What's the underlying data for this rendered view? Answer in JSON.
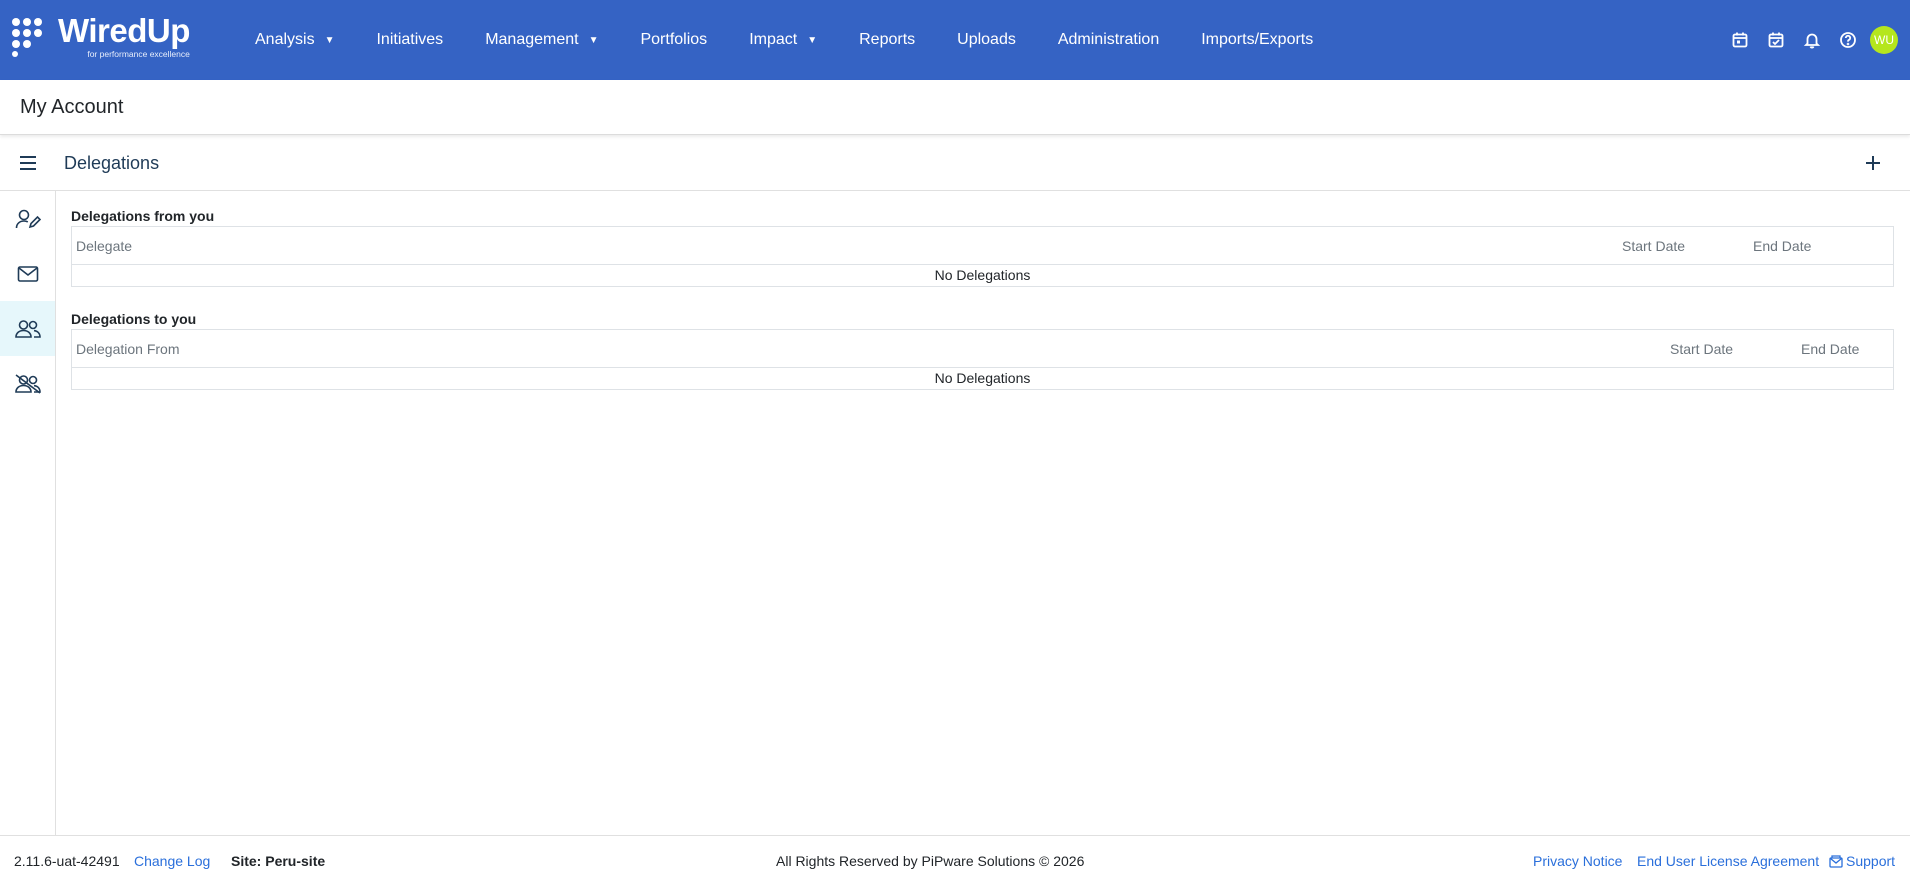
{
  "brand": {
    "name": "WiredUp",
    "tagline": "for performance excellence"
  },
  "nav": {
    "items": [
      {
        "label": "Analysis",
        "has_dropdown": true
      },
      {
        "label": "Initiatives",
        "has_dropdown": false
      },
      {
        "label": "Management",
        "has_dropdown": true
      },
      {
        "label": "Portfolios",
        "has_dropdown": false
      },
      {
        "label": "Impact",
        "has_dropdown": true
      },
      {
        "label": "Reports",
        "has_dropdown": false
      },
      {
        "label": "Uploads",
        "has_dropdown": false
      },
      {
        "label": "Administration",
        "has_dropdown": false
      },
      {
        "label": "Imports/Exports",
        "has_dropdown": false
      }
    ],
    "icons": [
      "calendar-icon",
      "calendar-check-icon",
      "bell-icon",
      "help-icon"
    ],
    "avatar_initials": "WU",
    "avatar_color": "#b5e61d",
    "bar_color": "#3563c4"
  },
  "page": {
    "title": "My Account"
  },
  "section": {
    "title": "Delegations",
    "add_icon": "plus-icon"
  },
  "rail": {
    "items": [
      {
        "icon": "user-edit-icon",
        "active": false
      },
      {
        "icon": "envelope-icon",
        "active": false
      },
      {
        "icon": "users-icon",
        "active": true
      },
      {
        "icon": "users-slash-icon",
        "active": false
      }
    ]
  },
  "delegations_from": {
    "title": "Delegations from you",
    "columns": [
      "Delegate",
      "Start Date",
      "End Date"
    ],
    "empty_text": "No Delegations"
  },
  "delegations_to": {
    "title": "Delegations to you",
    "columns": [
      "Delegation From",
      "Start Date",
      "End Date"
    ],
    "empty_text": "No Delegations"
  },
  "footer": {
    "version": "2.11.6-uat-42491",
    "change_log": "Change Log",
    "site": "Site: Peru-site",
    "rights": "All Rights Reserved by PiPware Solutions © 2026",
    "privacy": "Privacy Notice",
    "eula": "End User License Agreement",
    "support": "Support",
    "link_color": "#2a6fdb"
  }
}
